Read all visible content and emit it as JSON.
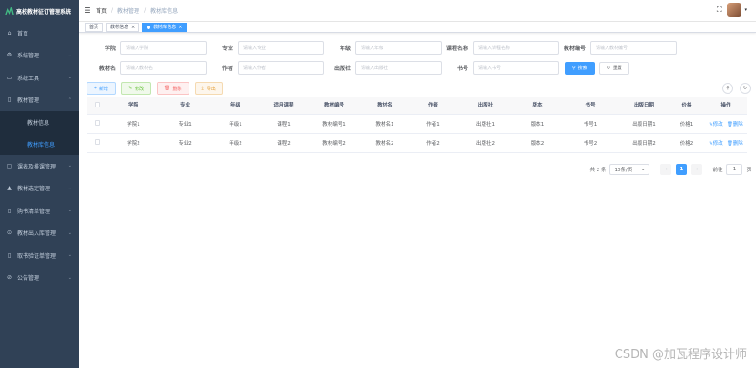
{
  "app": {
    "title": "高校教材征订管理系统"
  },
  "sidebar": {
    "items": [
      {
        "label": "首页",
        "icon": "home-icon",
        "glyph": "⌂"
      },
      {
        "label": "系统管理",
        "icon": "gear-icon",
        "glyph": "⚙",
        "arrow": "⌄"
      },
      {
        "label": "系统工具",
        "icon": "toolbox-icon",
        "glyph": "▭",
        "arrow": "⌄"
      },
      {
        "label": "教材管理",
        "icon": "book-icon",
        "glyph": "▯",
        "arrow": "⌃"
      }
    ],
    "sub_items": [
      {
        "label": "教材信息"
      },
      {
        "label": "教材库信息"
      }
    ],
    "items_after": [
      {
        "label": "课表及排课管理",
        "icon": "calendar-icon",
        "glyph": "▢",
        "arrow": "⌄"
      },
      {
        "label": "教材选定管理",
        "icon": "check-book-icon",
        "glyph": "▲",
        "arrow": "⌄"
      },
      {
        "label": "购书清单管理",
        "icon": "list-icon",
        "glyph": "▯",
        "arrow": "⌄"
      },
      {
        "label": "教材出入库管理",
        "icon": "warehouse-icon",
        "glyph": "⊙",
        "arrow": "⌄"
      },
      {
        "label": "取书验证单管理",
        "icon": "verify-icon",
        "glyph": "▯",
        "arrow": "⌄"
      },
      {
        "label": "公告管理",
        "icon": "notice-icon",
        "glyph": "⊘",
        "arrow": "⌄"
      }
    ]
  },
  "topbar": {
    "breadcrumbs": [
      "首页",
      "教材管理",
      "教材库信息"
    ],
    "hamburger": "☰",
    "fullscreen": "⛶",
    "caret": "▾"
  },
  "tags": [
    {
      "label": "首页",
      "active": false
    },
    {
      "label": "教材信息",
      "active": false,
      "close": "×"
    },
    {
      "label": "教材库信息",
      "active": true,
      "close": "×"
    }
  ],
  "search": {
    "fields_row1": [
      {
        "label": "学院",
        "placeholder": "请输入学院"
      },
      {
        "label": "专业",
        "placeholder": "请输入专业"
      },
      {
        "label": "年级",
        "placeholder": "请输入年级"
      },
      {
        "label": "课程名称",
        "placeholder": "请输入课程名称"
      },
      {
        "label": "教材编号",
        "placeholder": "请输入教材编号"
      }
    ],
    "fields_row2": [
      {
        "label": "教材名",
        "placeholder": "请输入教材名"
      },
      {
        "label": "作者",
        "placeholder": "请输入作者"
      },
      {
        "label": "出版社",
        "placeholder": "请输入出版社"
      },
      {
        "label": "书号",
        "placeholder": "请输入书号"
      }
    ],
    "search_label": "搜索",
    "reset_label": "重置"
  },
  "toolbar": {
    "add_label": "新增",
    "edit_label": "修改",
    "delete_label": "删除",
    "export_label": "导出"
  },
  "table": {
    "columns": [
      "学院",
      "专业",
      "年级",
      "适用课程",
      "教材编号",
      "教材名",
      "作者",
      "出版社",
      "版本",
      "书号",
      "出版日期",
      "价格",
      "操作"
    ],
    "rows": [
      [
        "学院1",
        "专业1",
        "年级1",
        "课程1",
        "教材编号1",
        "教材名1",
        "作者1",
        "出版社1",
        "版本1",
        "书号1",
        "出版日期1",
        "价格1"
      ],
      [
        "学院2",
        "专业2",
        "年级2",
        "课程2",
        "教材编号2",
        "教材名2",
        "作者2",
        "出版社2",
        "版本2",
        "书号2",
        "出版日期2",
        "价格2"
      ]
    ],
    "edit_action": "修改",
    "delete_action": "删除"
  },
  "pagination": {
    "total_text": "共 2 条",
    "page_size": "10条/页",
    "current_page": "1",
    "goto_label": "前往",
    "goto_value": "1",
    "page_unit": "页"
  },
  "watermark": "CSDN @加瓦程序设计师",
  "colors": {
    "sidebar_bg": "#304156",
    "primary": "#409eff"
  }
}
